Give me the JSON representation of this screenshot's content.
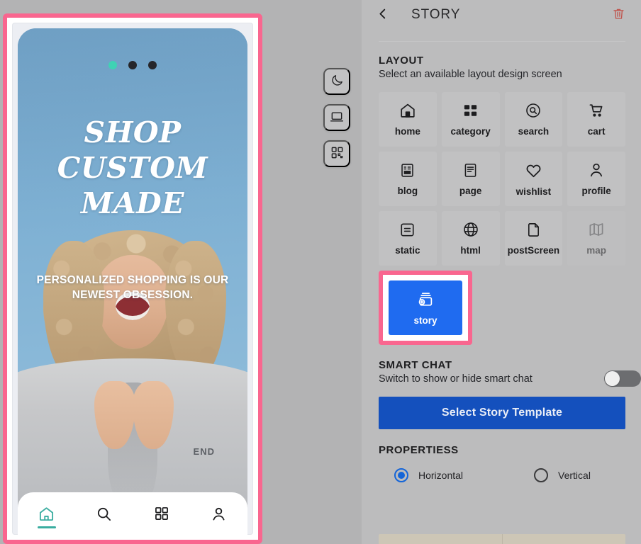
{
  "theme": {
    "app_background": "#b3b3b4",
    "panel_background": "#bcbcbd",
    "selection_pink": "#f9668f",
    "primary_blue": "#1f6bf0",
    "button_blue": "#1450bd",
    "accent_teal": "#3aada0",
    "story_dot_active": "#3fd2b4",
    "delete_red": "#c0564f"
  },
  "preview": {
    "name": "mobile-story-preview",
    "story_dots": [
      {
        "id": "dot-1",
        "active": true
      },
      {
        "id": "dot-2",
        "active": false
      },
      {
        "id": "dot-3",
        "active": false
      }
    ],
    "headline": "SHOP CUSTOM MADE",
    "subtitle": "PERSONALIZED SHOPPING IS OUR NEWEST OBSESSION.",
    "photo": {
      "alt": "Laughing woman with curly blonde hair in a grey sweatshirt on a blue background",
      "sweater_text": "END"
    },
    "bottom_nav": [
      {
        "icon": "home-icon",
        "label": "home",
        "active": true
      },
      {
        "icon": "search-icon",
        "label": "search",
        "active": false
      },
      {
        "icon": "grid-icon",
        "label": "category",
        "active": false
      },
      {
        "icon": "profile-icon",
        "label": "profile",
        "active": false
      }
    ]
  },
  "float_tools": [
    {
      "icon": "moon-icon",
      "label": "Dark mode"
    },
    {
      "icon": "laptop-icon",
      "label": "Desktop preview"
    },
    {
      "icon": "qrcode-icon",
      "label": "QR code"
    }
  ],
  "panel": {
    "back_icon": "chevron-left-icon",
    "title": "STORY",
    "delete_icon": "trash-icon",
    "layout": {
      "title": "LAYOUT",
      "subtitle": "Select an available layout design screen",
      "tiles": [
        {
          "icon": "home-icon",
          "label": "home",
          "state": "default"
        },
        {
          "icon": "category-icon",
          "label": "category",
          "state": "default"
        },
        {
          "icon": "search-icon",
          "label": "search",
          "state": "default"
        },
        {
          "icon": "cart-icon",
          "label": "cart",
          "state": "default"
        },
        {
          "icon": "blog-icon",
          "label": "blog",
          "state": "default"
        },
        {
          "icon": "page-icon",
          "label": "page",
          "state": "default"
        },
        {
          "icon": "heart-icon",
          "label": "wishlist",
          "state": "default"
        },
        {
          "icon": "profile-icon",
          "label": "profile",
          "state": "default"
        },
        {
          "icon": "static-icon",
          "label": "static",
          "state": "default"
        },
        {
          "icon": "globe-icon",
          "label": "html",
          "state": "default"
        },
        {
          "icon": "file-icon",
          "label": "postScreen",
          "state": "default"
        },
        {
          "icon": "map-icon",
          "label": "map",
          "state": "disabled"
        }
      ],
      "selected_tile": {
        "icon": "add-story-icon",
        "label": "story",
        "state": "selected"
      }
    },
    "smart_chat": {
      "title": "SMART CHAT",
      "subtitle": "Switch to show or hide smart chat",
      "toggle_state": "off",
      "button_label": "Select Story Template"
    },
    "properties": {
      "title": "PROPERTIESS",
      "options": [
        {
          "label": "Horizontal",
          "selected": true
        },
        {
          "label": "Vertical",
          "selected": false
        }
      ]
    }
  }
}
